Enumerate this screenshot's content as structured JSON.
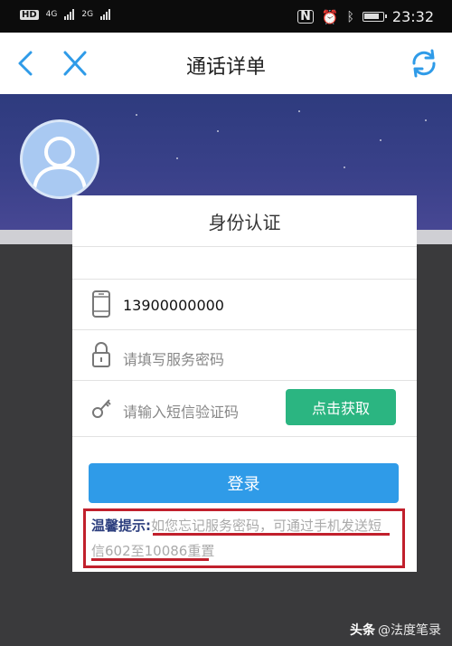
{
  "status_bar": {
    "left": [
      "HD",
      "4G",
      "2G"
    ],
    "time": "23:32"
  },
  "nav": {
    "title": "通话详单"
  },
  "card": {
    "title": "身份认证",
    "phone": "13900000000",
    "password_placeholder": "请填写服务密码",
    "code_placeholder": "请输入短信验证码",
    "get_code_label": "点击获取",
    "login_label": "登录"
  },
  "tip": {
    "label": "温馨提示:",
    "line1": "如您忘记服务密码，可通过手机发送短",
    "line2": "信602至10086重置"
  },
  "footer": {
    "app": "头条",
    "author": "@法度笔录"
  },
  "colors": {
    "accent_blue": "#2f9be8",
    "accent_green": "#2bb581",
    "tip_red": "#c1202c"
  }
}
